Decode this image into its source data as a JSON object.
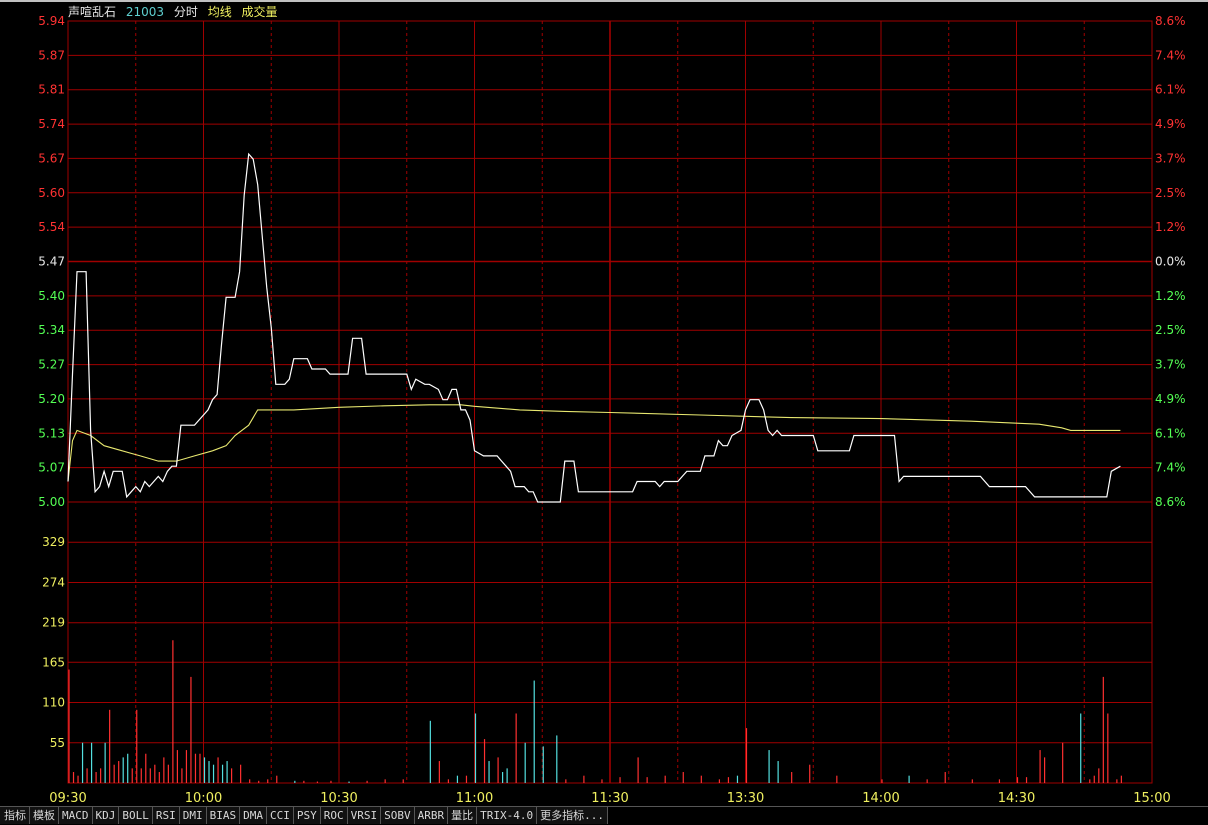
{
  "header": {
    "title": "声喧乱石",
    "code": "21003",
    "fenshi": "分时",
    "avg_label": "均线",
    "vol_label": "成交量"
  },
  "tabs": [
    "指标",
    "模板",
    "MACD",
    "KDJ",
    "BOLL",
    "RSI",
    "DMI",
    "BIAS",
    "DMA",
    "CCI",
    "PSY",
    "ROC",
    "VRSI",
    "SOBV",
    "ARBR",
    "量比",
    "TRIX-4.0",
    "更多指标..."
  ],
  "colors": {
    "up": "#ff3232",
    "down": "#54ff54",
    "flat": "#e8e8e8",
    "price_line": "#ffffff",
    "avg_line": "#e8e870",
    "volume_up": "#ff3030",
    "volume_down": "#54e0e0",
    "grid": "#a00000",
    "volume_tick": "#f0f060"
  },
  "chart_data": {
    "type": "line",
    "x_ticks": [
      "09:30",
      "10:00",
      "10:30",
      "11:00",
      "11:30",
      "13:30",
      "14:00",
      "14:30",
      "15:00"
    ],
    "price_axis": {
      "ticks": [
        "5.94",
        "5.87",
        "5.81",
        "5.74",
        "5.67",
        "5.60",
        "5.54",
        "5.47",
        "5.40",
        "5.34",
        "5.27",
        "5.20",
        "5.13",
        "5.07",
        "5.00"
      ],
      "ylim": [
        5.0,
        5.94
      ],
      "prev_close": 5.47
    },
    "pct_axis": {
      "ticks": [
        "8.6%",
        "7.4%",
        "6.1%",
        "4.9%",
        "3.7%",
        "2.5%",
        "1.2%",
        "0.0%",
        "1.2%",
        "2.5%",
        "3.7%",
        "4.9%",
        "6.1%",
        "7.4%",
        "8.6%"
      ]
    },
    "volume_axis": {
      "ticks": [
        "329",
        "274",
        "219",
        "165",
        "110",
        "55"
      ],
      "ylim": [
        0,
        384
      ]
    },
    "series": [
      {
        "key": "price",
        "points": [
          [
            0,
            5.04
          ],
          [
            1,
            5.25
          ],
          [
            2,
            5.45
          ],
          [
            4,
            5.45
          ],
          [
            5,
            5.14
          ],
          [
            6,
            5.02
          ],
          [
            7,
            5.03
          ],
          [
            8,
            5.06
          ],
          [
            9,
            5.03
          ],
          [
            10,
            5.06
          ],
          [
            12,
            5.06
          ],
          [
            13,
            5.01
          ],
          [
            14,
            5.02
          ],
          [
            15,
            5.03
          ],
          [
            16,
            5.02
          ],
          [
            17,
            5.04
          ],
          [
            18,
            5.03
          ],
          [
            19,
            5.04
          ],
          [
            20,
            5.05
          ],
          [
            21,
            5.04
          ],
          [
            22,
            5.06
          ],
          [
            23,
            5.07
          ],
          [
            24,
            5.07
          ],
          [
            25,
            5.15
          ],
          [
            28,
            5.15
          ],
          [
            30,
            5.17
          ],
          [
            31,
            5.18
          ],
          [
            32,
            5.2
          ],
          [
            33,
            5.21
          ],
          [
            34,
            5.31
          ],
          [
            35,
            5.4
          ],
          [
            37,
            5.4
          ],
          [
            38,
            5.45
          ],
          [
            39,
            5.6
          ],
          [
            40,
            5.68
          ],
          [
            41,
            5.67
          ],
          [
            42,
            5.62
          ],
          [
            43,
            5.52
          ],
          [
            44,
            5.42
          ],
          [
            45,
            5.34
          ],
          [
            46,
            5.23
          ],
          [
            48,
            5.23
          ],
          [
            49,
            5.24
          ],
          [
            50,
            5.28
          ],
          [
            51,
            5.28
          ],
          [
            53,
            5.28
          ],
          [
            54,
            5.26
          ],
          [
            57,
            5.26
          ],
          [
            58,
            5.25
          ],
          [
            62,
            5.25
          ],
          [
            63,
            5.32
          ],
          [
            65,
            5.32
          ],
          [
            66,
            5.25
          ],
          [
            75,
            5.25
          ],
          [
            76,
            5.22
          ],
          [
            77,
            5.24
          ],
          [
            79,
            5.23
          ],
          [
            80,
            5.23
          ],
          [
            82,
            5.22
          ],
          [
            83,
            5.2
          ],
          [
            84,
            5.2
          ],
          [
            85,
            5.22
          ],
          [
            86,
            5.22
          ],
          [
            87,
            5.18
          ],
          [
            88,
            5.18
          ],
          [
            89,
            5.16
          ],
          [
            90,
            5.1
          ],
          [
            92,
            5.09
          ],
          [
            95,
            5.09
          ],
          [
            96,
            5.08
          ],
          [
            97,
            5.07
          ],
          [
            98,
            5.06
          ],
          [
            99,
            5.03
          ],
          [
            101,
            5.03
          ],
          [
            102,
            5.02
          ],
          [
            103,
            5.02
          ],
          [
            104,
            5.0
          ],
          [
            109,
            5.0
          ],
          [
            110,
            5.08
          ],
          [
            112,
            5.08
          ],
          [
            113,
            5.02
          ],
          [
            125,
            5.02
          ],
          [
            126,
            5.04
          ],
          [
            130,
            5.04
          ],
          [
            131,
            5.03
          ],
          [
            132,
            5.04
          ],
          [
            135,
            5.04
          ],
          [
            136,
            5.05
          ],
          [
            137,
            5.06
          ],
          [
            140,
            5.06
          ],
          [
            141,
            5.09
          ],
          [
            143,
            5.09
          ],
          [
            144,
            5.12
          ],
          [
            145,
            5.11
          ],
          [
            146,
            5.11
          ],
          [
            147,
            5.13
          ],
          [
            149,
            5.14
          ],
          [
            150,
            5.18
          ],
          [
            151,
            5.2
          ],
          [
            152,
            5.2
          ],
          [
            153,
            5.2
          ],
          [
            154,
            5.18
          ],
          [
            155,
            5.14
          ],
          [
            156,
            5.13
          ],
          [
            157,
            5.14
          ],
          [
            158,
            5.13
          ],
          [
            165,
            5.13
          ],
          [
            166,
            5.1
          ],
          [
            173,
            5.1
          ],
          [
            174,
            5.13
          ],
          [
            183,
            5.13
          ],
          [
            184,
            5.04
          ],
          [
            185,
            5.05
          ],
          [
            202,
            5.05
          ],
          [
            204,
            5.03
          ],
          [
            212,
            5.03
          ],
          [
            214,
            5.01
          ],
          [
            222,
            5.01
          ],
          [
            230,
            5.01
          ],
          [
            231,
            5.06
          ],
          [
            233,
            5.07
          ]
        ]
      },
      {
        "key": "avg",
        "points": [
          [
            0,
            5.04
          ],
          [
            1,
            5.12
          ],
          [
            2,
            5.14
          ],
          [
            5,
            5.13
          ],
          [
            8,
            5.11
          ],
          [
            12,
            5.1
          ],
          [
            16,
            5.09
          ],
          [
            20,
            5.08
          ],
          [
            24,
            5.08
          ],
          [
            28,
            5.09
          ],
          [
            32,
            5.1
          ],
          [
            35,
            5.11
          ],
          [
            37,
            5.13
          ],
          [
            40,
            5.15
          ],
          [
            42,
            5.18
          ],
          [
            46,
            5.18
          ],
          [
            50,
            5.18
          ],
          [
            60,
            5.185
          ],
          [
            70,
            5.188
          ],
          [
            80,
            5.19
          ],
          [
            87,
            5.19
          ],
          [
            90,
            5.187
          ],
          [
            100,
            5.18
          ],
          [
            110,
            5.177
          ],
          [
            120,
            5.175
          ],
          [
            140,
            5.17
          ],
          [
            160,
            5.165
          ],
          [
            180,
            5.163
          ],
          [
            200,
            5.158
          ],
          [
            210,
            5.154
          ],
          [
            215,
            5.152
          ],
          [
            220,
            5.145
          ],
          [
            222,
            5.14
          ],
          [
            233,
            5.14
          ]
        ]
      }
    ],
    "volume": [
      [
        0,
        155,
        "u"
      ],
      [
        1,
        15,
        "u"
      ],
      [
        2,
        10,
        "u"
      ],
      [
        3,
        55,
        "d"
      ],
      [
        4,
        20,
        "u"
      ],
      [
        5,
        55,
        "d"
      ],
      [
        6,
        15,
        "u"
      ],
      [
        7,
        20,
        "u"
      ],
      [
        8,
        55,
        "d"
      ],
      [
        9,
        100,
        "u"
      ],
      [
        10,
        25,
        "u"
      ],
      [
        11,
        30,
        "u"
      ],
      [
        12,
        35,
        "d"
      ],
      [
        13,
        40,
        "d"
      ],
      [
        14,
        20,
        "u"
      ],
      [
        15,
        100,
        "u"
      ],
      [
        16,
        20,
        "u"
      ],
      [
        17,
        40,
        "u"
      ],
      [
        18,
        20,
        "u"
      ],
      [
        19,
        25,
        "u"
      ],
      [
        20,
        15,
        "u"
      ],
      [
        21,
        35,
        "u"
      ],
      [
        22,
        25,
        "u"
      ],
      [
        23,
        195,
        "u"
      ],
      [
        24,
        45,
        "u"
      ],
      [
        25,
        20,
        "u"
      ],
      [
        26,
        45,
        "u"
      ],
      [
        27,
        145,
        "u"
      ],
      [
        28,
        40,
        "u"
      ],
      [
        29,
        40,
        "u"
      ],
      [
        30,
        35,
        "d"
      ],
      [
        31,
        30,
        "d"
      ],
      [
        32,
        25,
        "d"
      ],
      [
        33,
        35,
        "u"
      ],
      [
        34,
        25,
        "d"
      ],
      [
        35,
        30,
        "d"
      ],
      [
        36,
        20,
        "u"
      ],
      [
        38,
        25,
        "u"
      ],
      [
        40,
        5,
        "u"
      ],
      [
        42,
        3,
        "u"
      ],
      [
        44,
        5,
        "u"
      ],
      [
        46,
        10,
        "u"
      ],
      [
        50,
        3,
        "d"
      ],
      [
        52,
        3,
        "u"
      ],
      [
        55,
        2,
        "u"
      ],
      [
        58,
        3,
        "u"
      ],
      [
        62,
        2,
        "d"
      ],
      [
        66,
        3,
        "u"
      ],
      [
        70,
        5,
        "u"
      ],
      [
        74,
        5,
        "u"
      ],
      [
        80,
        85,
        "d"
      ],
      [
        82,
        30,
        "u"
      ],
      [
        84,
        5,
        "u"
      ],
      [
        86,
        10,
        "d"
      ],
      [
        88,
        10,
        "u"
      ],
      [
        90,
        95,
        "d"
      ],
      [
        92,
        60,
        "u"
      ],
      [
        93,
        30,
        "d"
      ],
      [
        95,
        35,
        "u"
      ],
      [
        96,
        15,
        "d"
      ],
      [
        97,
        20,
        "d"
      ],
      [
        99,
        95,
        "u"
      ],
      [
        101,
        55,
        "d"
      ],
      [
        103,
        140,
        "d"
      ],
      [
        105,
        50,
        "d"
      ],
      [
        108,
        65,
        "d"
      ],
      [
        110,
        5,
        "u"
      ],
      [
        114,
        10,
        "u"
      ],
      [
        118,
        5,
        "u"
      ],
      [
        122,
        8,
        "u"
      ],
      [
        126,
        35,
        "u"
      ],
      [
        128,
        8,
        "u"
      ],
      [
        132,
        10,
        "u"
      ],
      [
        136,
        15,
        "u"
      ],
      [
        140,
        10,
        "u"
      ],
      [
        144,
        5,
        "u"
      ],
      [
        146,
        8,
        "u"
      ],
      [
        148,
        10,
        "d"
      ],
      [
        150,
        75,
        "u"
      ],
      [
        155,
        45,
        "d"
      ],
      [
        157,
        30,
        "d"
      ],
      [
        160,
        15,
        "u"
      ],
      [
        164,
        25,
        "u"
      ],
      [
        170,
        10,
        "u"
      ],
      [
        180,
        5,
        "u"
      ],
      [
        186,
        10,
        "d"
      ],
      [
        190,
        5,
        "u"
      ],
      [
        194,
        15,
        "u"
      ],
      [
        200,
        5,
        "u"
      ],
      [
        206,
        5,
        "u"
      ],
      [
        210,
        8,
        "u"
      ],
      [
        212,
        8,
        "u"
      ],
      [
        215,
        45,
        "u"
      ],
      [
        216,
        35,
        "u"
      ],
      [
        220,
        55,
        "u"
      ],
      [
        224,
        95,
        "d"
      ],
      [
        226,
        5,
        "u"
      ],
      [
        227,
        10,
        "u"
      ],
      [
        228,
        20,
        "u"
      ],
      [
        229,
        145,
        "u"
      ],
      [
        230,
        95,
        "u"
      ],
      [
        232,
        5,
        "u"
      ],
      [
        233,
        10,
        "u"
      ]
    ]
  }
}
